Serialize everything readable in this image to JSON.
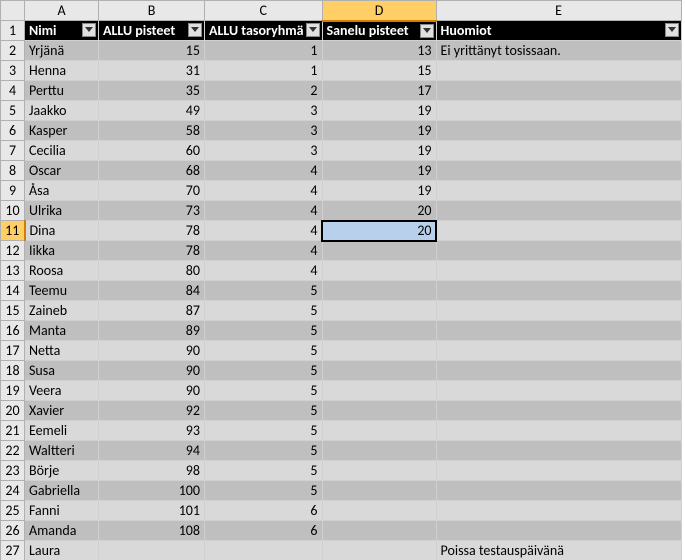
{
  "columns": [
    "A",
    "B",
    "C",
    "D",
    "E"
  ],
  "headers": {
    "A": "Nimi",
    "B": "ALLU pisteet",
    "C": "ALLU tasoryhmä",
    "D": "Sanelu pisteet",
    "E": "Huomiot"
  },
  "rows": [
    {
      "n": 2,
      "name": "Yrjänä",
      "allu": 15,
      "taso": 1,
      "sanelu": 13,
      "huomio": "Ei yrittänyt tosissaan."
    },
    {
      "n": 3,
      "name": "Henna",
      "allu": 31,
      "taso": 1,
      "sanelu": 15,
      "huomio": ""
    },
    {
      "n": 4,
      "name": "Perttu",
      "allu": 35,
      "taso": 2,
      "sanelu": 17,
      "huomio": ""
    },
    {
      "n": 5,
      "name": "Jaakko",
      "allu": 49,
      "taso": 3,
      "sanelu": 19,
      "huomio": ""
    },
    {
      "n": 6,
      "name": "Kasper",
      "allu": 58,
      "taso": 3,
      "sanelu": 19,
      "huomio": ""
    },
    {
      "n": 7,
      "name": "Cecilia",
      "allu": 60,
      "taso": 3,
      "sanelu": 19,
      "huomio": ""
    },
    {
      "n": 8,
      "name": "Oscar",
      "allu": 68,
      "taso": 4,
      "sanelu": 19,
      "huomio": ""
    },
    {
      "n": 9,
      "name": "Åsa",
      "allu": 70,
      "taso": 4,
      "sanelu": 19,
      "huomio": ""
    },
    {
      "n": 10,
      "name": "Ulrika",
      "allu": 73,
      "taso": 4,
      "sanelu": 20,
      "huomio": ""
    },
    {
      "n": 11,
      "name": "Dina",
      "allu": 78,
      "taso": 4,
      "sanelu": 20,
      "huomio": ""
    },
    {
      "n": 12,
      "name": "Iikka",
      "allu": 78,
      "taso": 4,
      "sanelu": "",
      "huomio": ""
    },
    {
      "n": 13,
      "name": "Roosa",
      "allu": 80,
      "taso": 4,
      "sanelu": "",
      "huomio": ""
    },
    {
      "n": 14,
      "name": "Teemu",
      "allu": 84,
      "taso": 5,
      "sanelu": "",
      "huomio": ""
    },
    {
      "n": 15,
      "name": "Zaineb",
      "allu": 87,
      "taso": 5,
      "sanelu": "",
      "huomio": ""
    },
    {
      "n": 16,
      "name": "Manta",
      "allu": 89,
      "taso": 5,
      "sanelu": "",
      "huomio": ""
    },
    {
      "n": 17,
      "name": "Netta",
      "allu": 90,
      "taso": 5,
      "sanelu": "",
      "huomio": ""
    },
    {
      "n": 18,
      "name": "Susa",
      "allu": 90,
      "taso": 5,
      "sanelu": "",
      "huomio": ""
    },
    {
      "n": 19,
      "name": "Veera",
      "allu": 90,
      "taso": 5,
      "sanelu": "",
      "huomio": ""
    },
    {
      "n": 20,
      "name": "Xavier",
      "allu": 92,
      "taso": 5,
      "sanelu": "",
      "huomio": ""
    },
    {
      "n": 21,
      "name": "Eemeli",
      "allu": 93,
      "taso": 5,
      "sanelu": "",
      "huomio": ""
    },
    {
      "n": 22,
      "name": "Waltteri",
      "allu": 94,
      "taso": 5,
      "sanelu": "",
      "huomio": ""
    },
    {
      "n": 23,
      "name": "Börje",
      "allu": 98,
      "taso": 5,
      "sanelu": "",
      "huomio": ""
    },
    {
      "n": 24,
      "name": "Gabriella",
      "allu": 100,
      "taso": 5,
      "sanelu": "",
      "huomio": ""
    },
    {
      "n": 25,
      "name": "Fanni",
      "allu": 101,
      "taso": 6,
      "sanelu": "",
      "huomio": ""
    },
    {
      "n": 26,
      "name": "Amanda",
      "allu": 108,
      "taso": 6,
      "sanelu": "",
      "huomio": ""
    },
    {
      "n": 27,
      "name": "Laura",
      "allu": "",
      "taso": "",
      "sanelu": "",
      "huomio": "Poissa testauspäivänä"
    }
  ],
  "selected": {
    "col": "D",
    "row": 11
  },
  "copyRange": {
    "col": "D",
    "startRow": 2,
    "endRow": 27
  },
  "fillTipRow": 24,
  "fillTipValue": "20",
  "chart_data": {
    "type": "table",
    "columns": [
      "Nimi",
      "ALLU pisteet",
      "ALLU tasoryhmä",
      "Sanelu pisteet",
      "Huomiot"
    ],
    "data": [
      [
        "Yrjänä",
        15,
        1,
        13,
        "Ei yrittänyt tosissaan."
      ],
      [
        "Henna",
        31,
        1,
        15,
        ""
      ],
      [
        "Perttu",
        35,
        2,
        17,
        ""
      ],
      [
        "Jaakko",
        49,
        3,
        19,
        ""
      ],
      [
        "Kasper",
        58,
        3,
        19,
        ""
      ],
      [
        "Cecilia",
        60,
        3,
        19,
        ""
      ],
      [
        "Oscar",
        68,
        4,
        19,
        ""
      ],
      [
        "Åsa",
        70,
        4,
        19,
        ""
      ],
      [
        "Ulrika",
        73,
        4,
        20,
        ""
      ],
      [
        "Dina",
        78,
        4,
        20,
        ""
      ],
      [
        "Iikka",
        78,
        4,
        null,
        ""
      ],
      [
        "Roosa",
        80,
        4,
        null,
        ""
      ],
      [
        "Teemu",
        84,
        5,
        null,
        ""
      ],
      [
        "Zaineb",
        87,
        5,
        null,
        ""
      ],
      [
        "Manta",
        89,
        5,
        null,
        ""
      ],
      [
        "Netta",
        90,
        5,
        null,
        ""
      ],
      [
        "Susa",
        90,
        5,
        null,
        ""
      ],
      [
        "Veera",
        90,
        5,
        null,
        ""
      ],
      [
        "Xavier",
        92,
        5,
        null,
        ""
      ],
      [
        "Eemeli",
        93,
        5,
        null,
        ""
      ],
      [
        "Waltteri",
        94,
        5,
        null,
        ""
      ],
      [
        "Börje",
        98,
        5,
        null,
        ""
      ],
      [
        "Gabriella",
        100,
        5,
        null,
        ""
      ],
      [
        "Fanni",
        101,
        6,
        null,
        ""
      ],
      [
        "Amanda",
        108,
        6,
        null,
        ""
      ],
      [
        "Laura",
        null,
        null,
        null,
        "Poissa testauspäivänä"
      ]
    ]
  }
}
